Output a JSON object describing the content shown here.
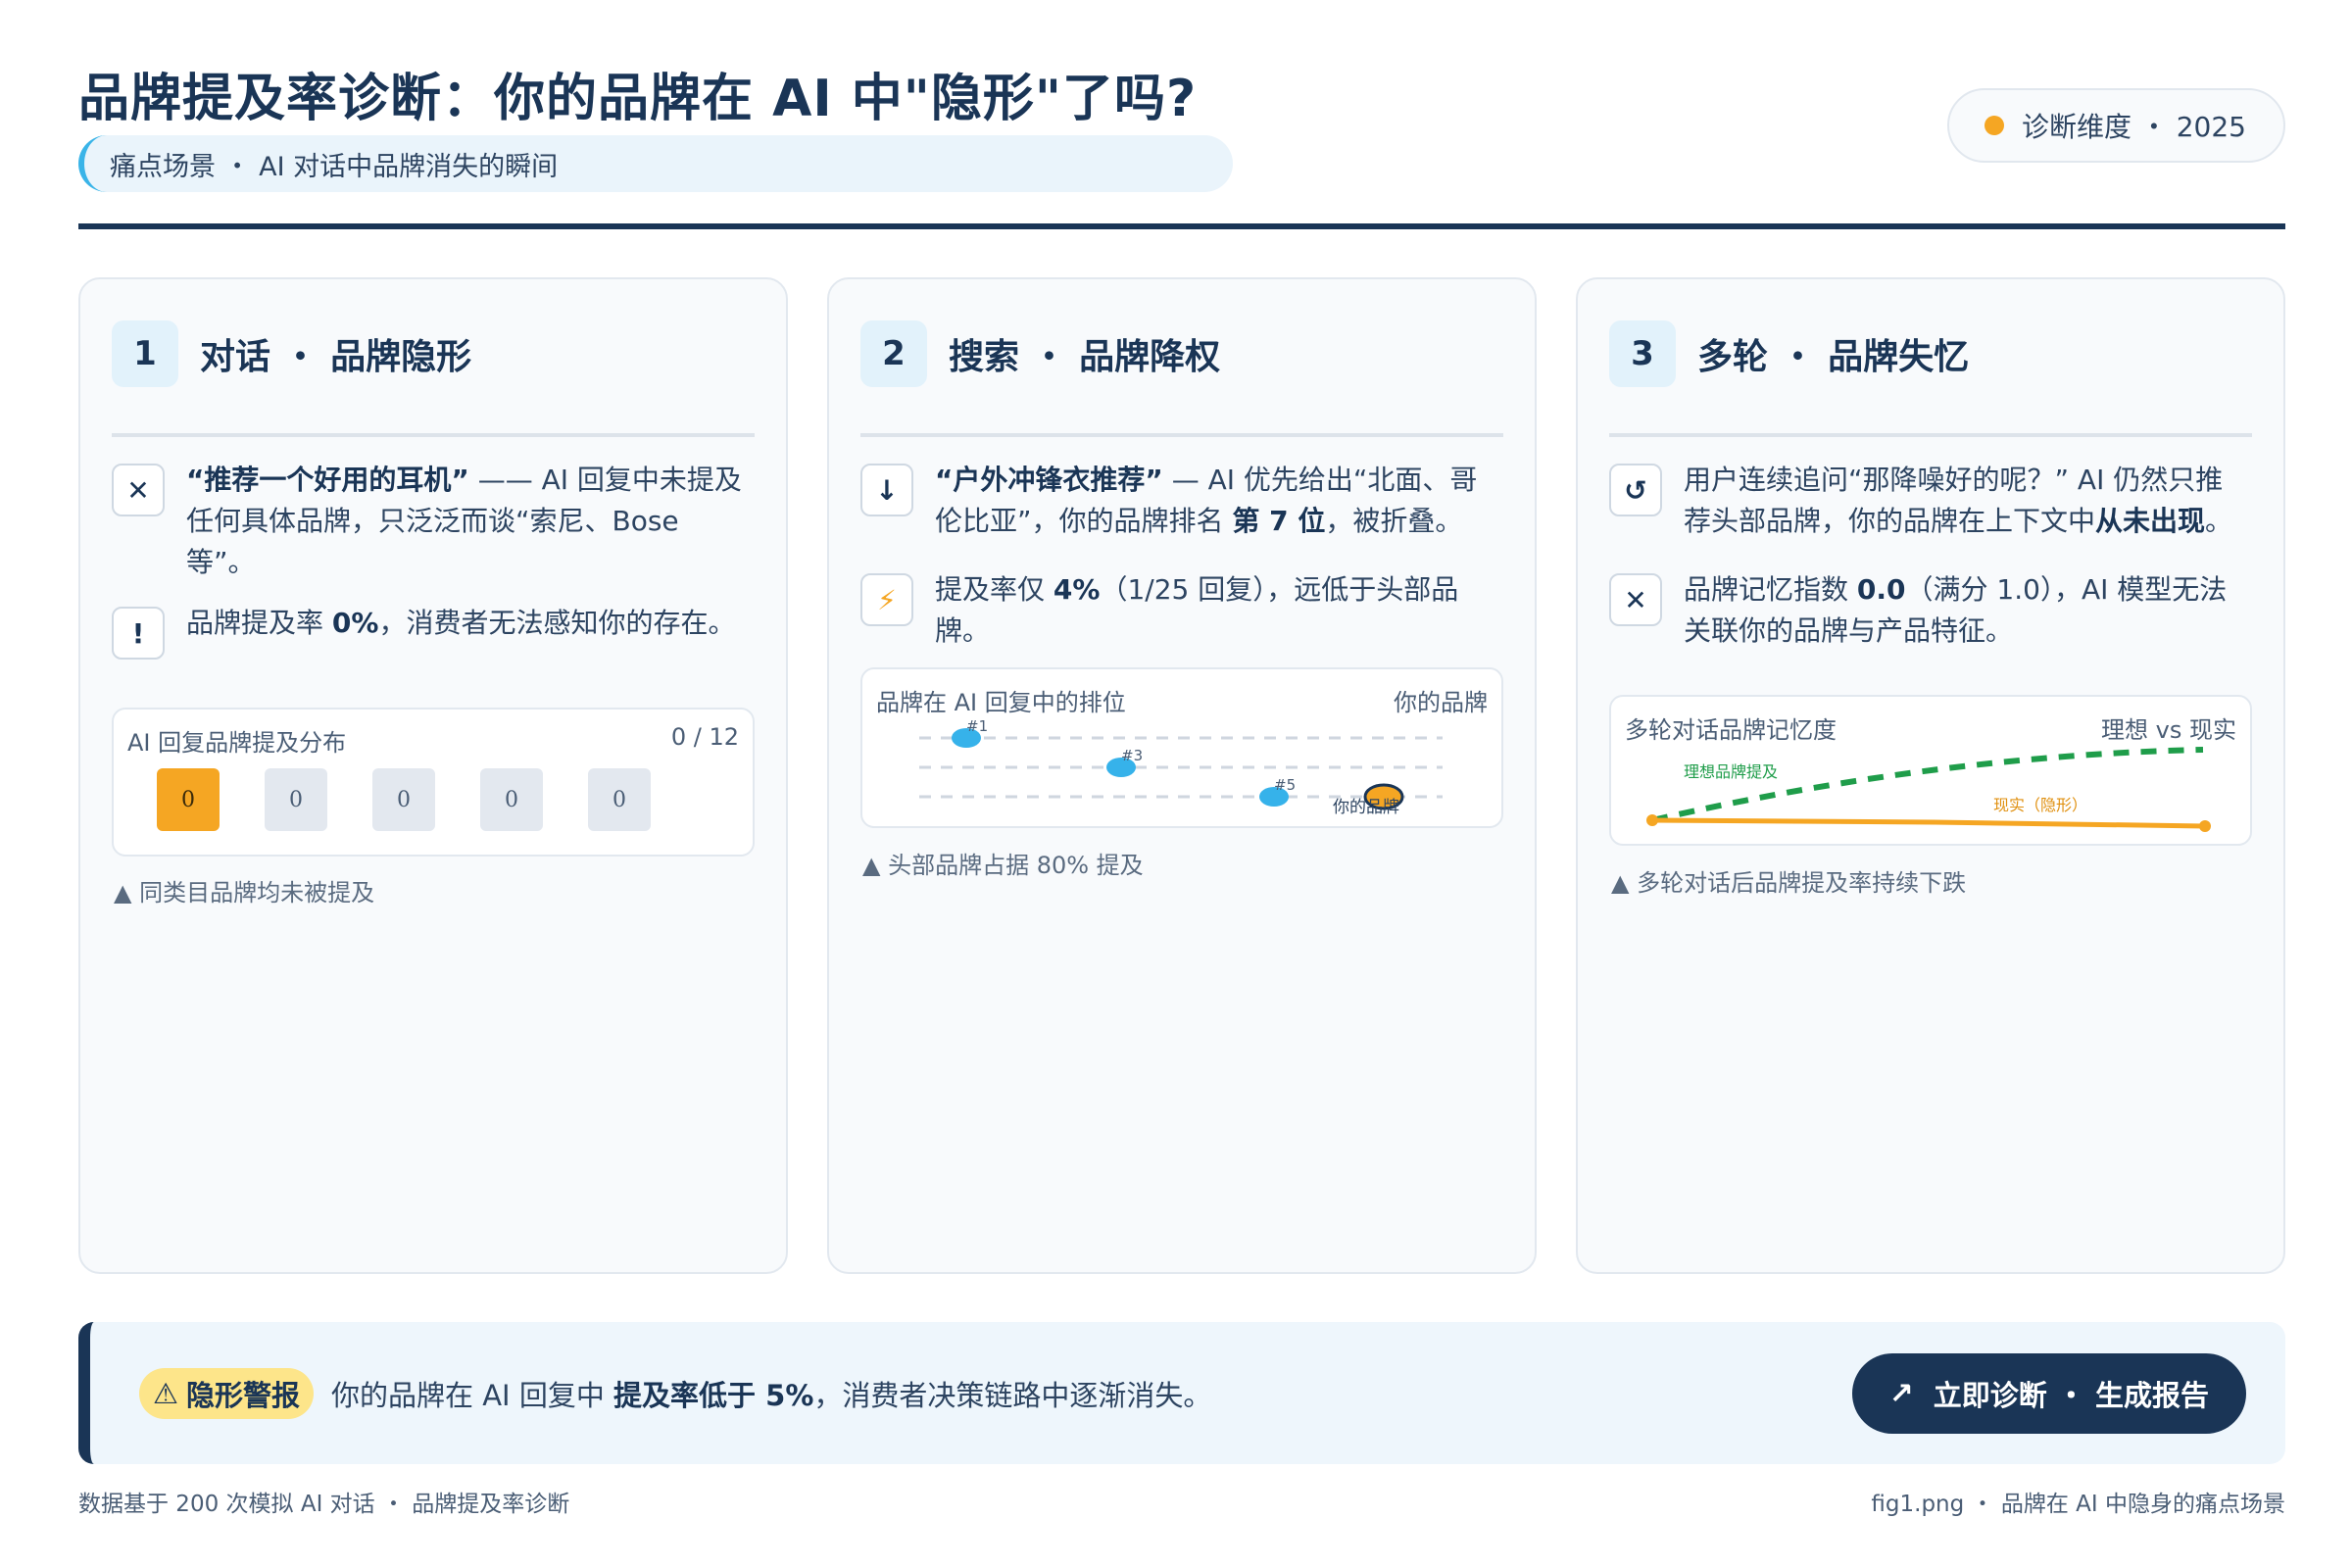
{
  "header": {
    "title": "品牌提及率诊断：你的品牌在 AI 中\"隐形\"了吗?",
    "subtitle": "痛点场景 ・ AI 对话中品牌消失的瞬间",
    "badge": "诊断维度 ・ 2025"
  },
  "cards": [
    {
      "num": "1",
      "title": "对话 ・ 品牌隐形",
      "items": [
        {
          "icon": "close-icon",
          "glyph": "✕",
          "strong": "“推荐一个好用的耳机”",
          "text": " —— AI 回复中未提及任何具体品牌，只泛泛而谈“索尼、Bose 等”。"
        },
        {
          "icon": "exclamation-icon",
          "glyph": "!",
          "pre": "品牌提及率 ",
          "strong": "0%",
          "text": "，消费者无法感知你的存在。"
        }
      ],
      "panel": {
        "label": "AI 回复品牌提及分布",
        "count": "0 / 12",
        "cells": [
          "0",
          "0",
          "0",
          "0",
          "0"
        ]
      },
      "note": "▲ 同类目品牌均未被提及"
    },
    {
      "num": "2",
      "title": "搜索 ・ 品牌降权",
      "items": [
        {
          "icon": "arrow-down-icon",
          "glyph": "↓",
          "strong": "“户外冲锋衣推荐”",
          "text": " — AI 优先给出“北面、哥伦比亚”，你的品牌排名 ",
          "strong2": "第 7 位",
          "post": "，被折叠。"
        },
        {
          "icon": "lightning-icon",
          "glyph": "⚡",
          "pre": "提及率仅 ",
          "strong": "4%",
          "text": "（1/25 回复），远低于头部品牌。"
        }
      ],
      "panel": {
        "label": "品牌在 AI 回复中的排位",
        "right": "你的品牌",
        "markers": [
          "#1",
          "#3",
          "#5"
        ],
        "own_label": "你的品牌"
      },
      "note": "▲ 头部品牌占据 80% 提及"
    },
    {
      "num": "3",
      "title": "多轮 ・ 品牌失忆",
      "items": [
        {
          "icon": "refresh-icon",
          "glyph": "↺",
          "text": "用户连续追问“那降噪好的呢？” AI 仍然只推荐头部品牌，你的品牌在上下文中",
          "strong": "从未出现",
          "post": "。"
        },
        {
          "icon": "close-icon",
          "glyph": "✕",
          "pre": "品牌记忆指数 ",
          "strong": "0.0",
          "text": "（满分 1.0），AI 模型无法关联你的品牌与产品特征。"
        }
      ],
      "panel": {
        "label": "多轮对话品牌记忆度",
        "right": "理想 vs 现实",
        "ideal_label": "理想品牌提及",
        "real_label": "现实（隐形）"
      },
      "note": "▲ 多轮对话后品牌提及率持续下跌"
    }
  ],
  "banner": {
    "tag": "隐形警报",
    "pre": "你的品牌在 AI 回复中 ",
    "strong": "提及率低于 5%",
    "post": "，消费者决策链路中逐渐消失。",
    "cta": "立即诊断 ・ 生成报告"
  },
  "footer": {
    "left": "数据基于 200 次模拟 AI 对话 ・ 品牌提及率诊断",
    "right": "fig1.png ・ 品牌在 AI 中隐身的痛点场景"
  },
  "colors": {
    "navy": "#1a3556",
    "accent_orange": "#f5a623",
    "accent_blue": "#3ab4e8",
    "ideal_green": "#1f9d4a"
  }
}
